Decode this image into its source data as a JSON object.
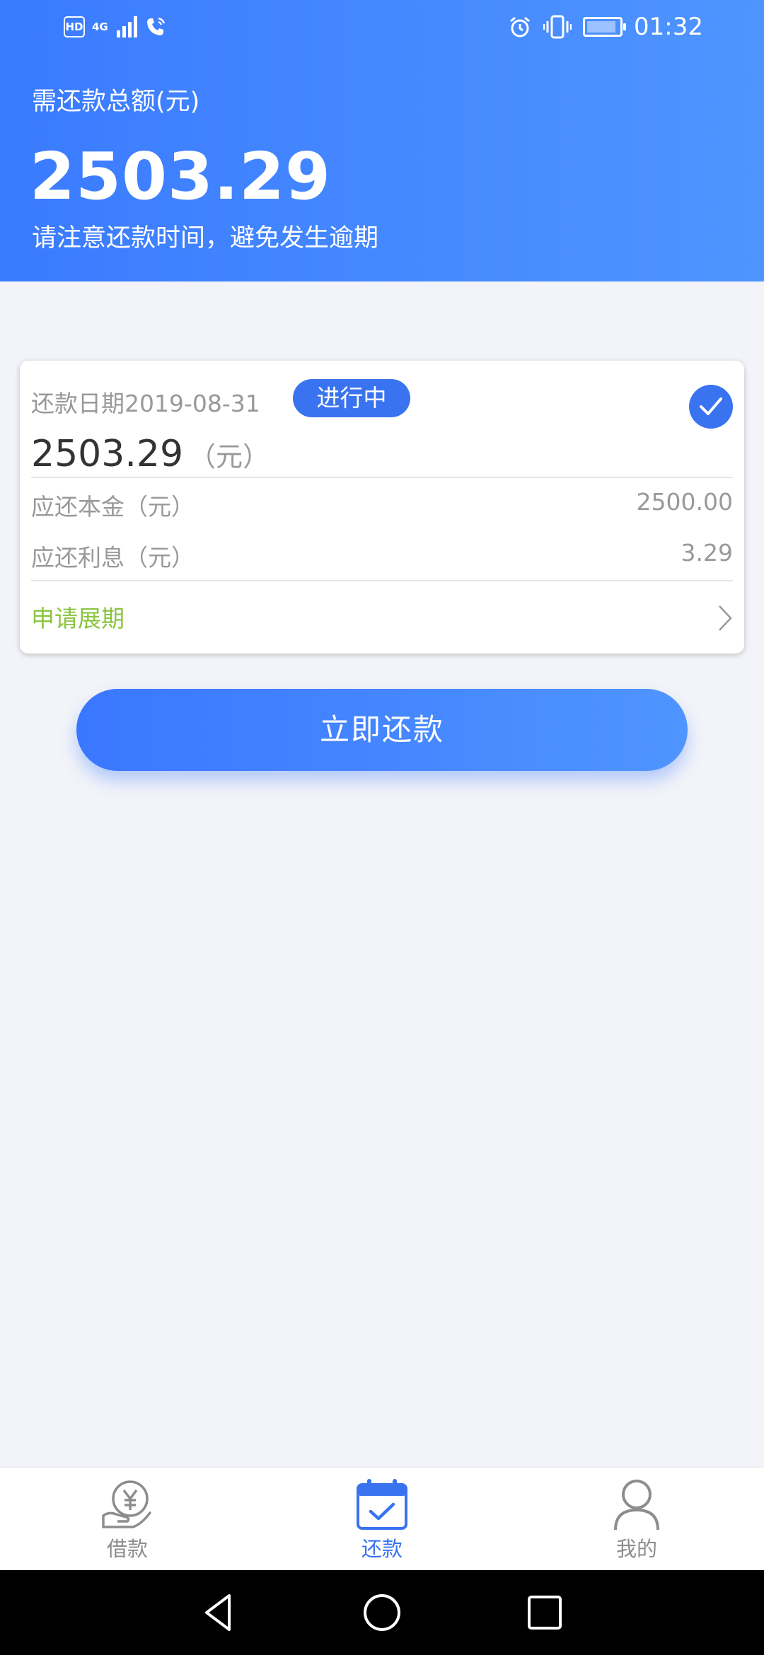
{
  "status_bar": {
    "network": "4G",
    "hd_badge": "HD",
    "time": "01:32"
  },
  "header": {
    "total_label": "需还款总额(元)",
    "total_amount": "2503.29",
    "note": "请注意还款时间，避免发生逾期"
  },
  "card": {
    "due_date": "还款日期2019-08-31",
    "status": "进行中",
    "amount": "2503.29",
    "amount_unit": "（元）",
    "rows": [
      {
        "label": "应还本金（元）",
        "value": "2500.00"
      },
      {
        "label": "应还利息（元）",
        "value": "3.29"
      }
    ],
    "extend_link": "申请展期"
  },
  "repay_button": "立即还款",
  "tabs": [
    {
      "label": "借款",
      "icon": "loan-yen-hand-icon",
      "active": false
    },
    {
      "label": "还款",
      "icon": "calendar-check-icon",
      "active": true
    },
    {
      "label": "我的",
      "icon": "user-profile-icon",
      "active": false
    }
  ],
  "colors": {
    "header_start": "#3a7bff",
    "header_end": "#4f95ff",
    "primary": "#3a73ef",
    "link_green": "#8ac43f",
    "background": "#f3f4f9"
  }
}
